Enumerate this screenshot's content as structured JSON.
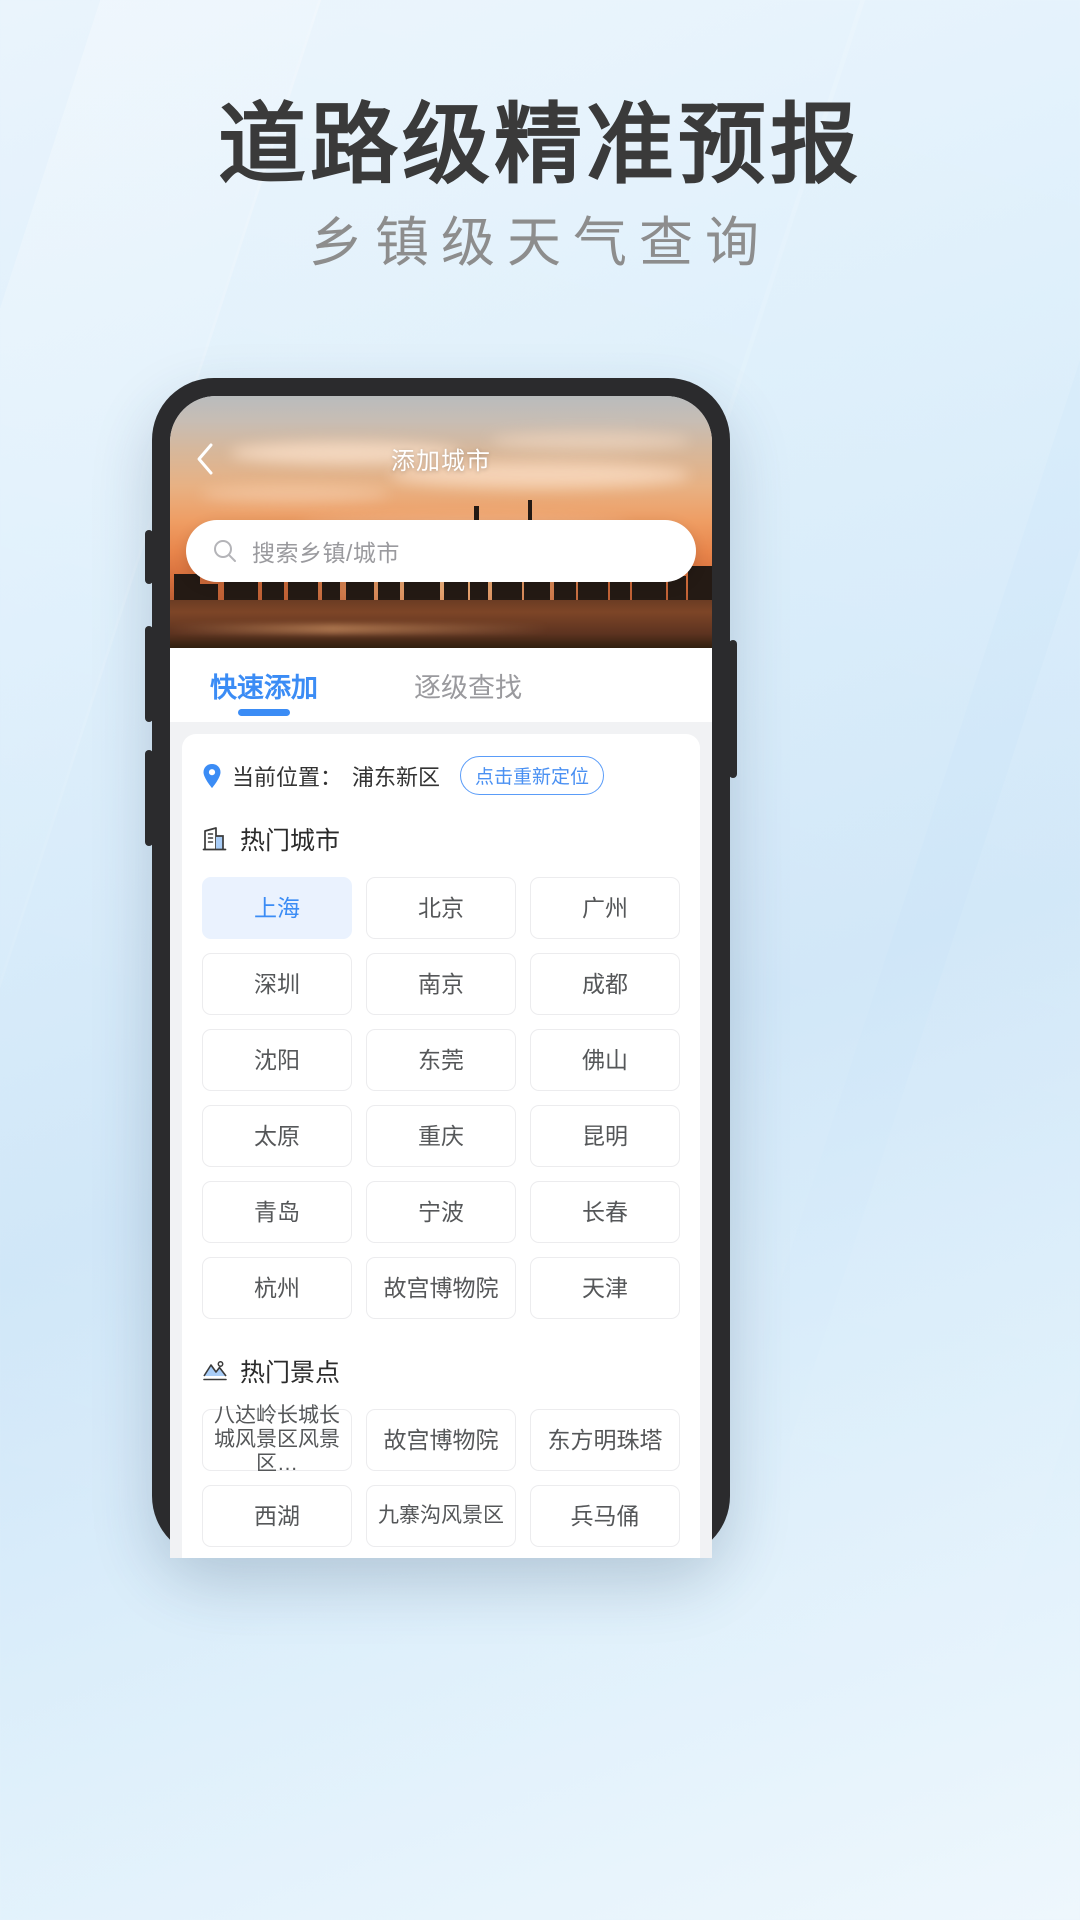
{
  "promo": {
    "headline": "道路级精准预报",
    "subheadline": "乡镇级天气查询"
  },
  "colors": {
    "accent": "#3b8cf5",
    "chip_selected_bg": "#eaf2fe",
    "background_top": "#eaf4fc",
    "phone_frame": "#2b2b2d",
    "muted_text": "#9a9a9e"
  },
  "app": {
    "nav": {
      "back_icon": "chevron-left-icon",
      "title": "添加城市"
    },
    "search": {
      "icon": "search-icon",
      "placeholder": "搜索乡镇/城市",
      "value": ""
    },
    "tabs": [
      {
        "label": "快速添加",
        "active": true
      },
      {
        "label": "逐级查找",
        "active": false
      }
    ],
    "location": {
      "icon": "location-pin-icon",
      "label": "当前位置：",
      "value": "浦东新区",
      "relocate_button": "点击重新定位"
    },
    "hot_cities": {
      "icon": "building-icon",
      "title": "热门城市",
      "items": [
        {
          "name": "上海",
          "selected": true
        },
        {
          "name": "北京",
          "selected": false
        },
        {
          "name": "广州",
          "selected": false
        },
        {
          "name": "深圳",
          "selected": false
        },
        {
          "name": "南京",
          "selected": false
        },
        {
          "name": "成都",
          "selected": false
        },
        {
          "name": "沈阳",
          "selected": false
        },
        {
          "name": "东莞",
          "selected": false
        },
        {
          "name": "佛山",
          "selected": false
        },
        {
          "name": "太原",
          "selected": false
        },
        {
          "name": "重庆",
          "selected": false
        },
        {
          "name": "昆明",
          "selected": false
        },
        {
          "name": "青岛",
          "selected": false
        },
        {
          "name": "宁波",
          "selected": false
        },
        {
          "name": "长春",
          "selected": false
        },
        {
          "name": "杭州",
          "selected": false
        },
        {
          "name": "故宫博物院",
          "selected": false
        },
        {
          "name": "天津",
          "selected": false
        }
      ]
    },
    "hot_spots": {
      "icon": "mountain-icon",
      "title": "热门景点",
      "items": [
        {
          "name": "八达岭长城长城风景区风景区…",
          "selected": false
        },
        {
          "name": "故宫博物院",
          "selected": false
        },
        {
          "name": "东方明珠塔",
          "selected": false
        },
        {
          "name": "西湖",
          "selected": false
        },
        {
          "name": "九寨沟风景区",
          "selected": false
        },
        {
          "name": "兵马俑",
          "selected": false
        }
      ]
    }
  }
}
